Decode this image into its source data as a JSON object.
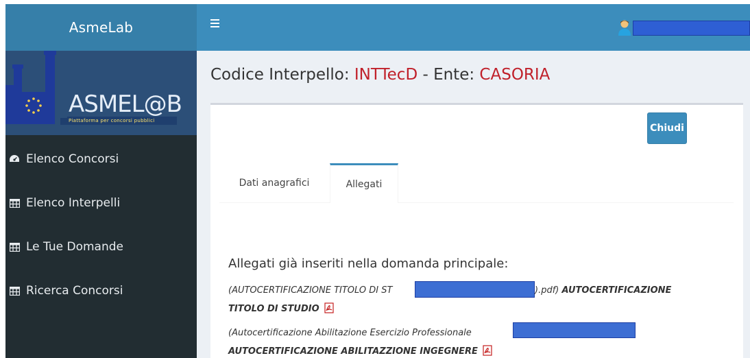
{
  "sidebar": {
    "brand": "AsmeLab",
    "logo_text": "ASMEL@B",
    "logo_sub": "Piattaforma per concorsi pubblici",
    "items": [
      {
        "label": "Elenco Concorsi",
        "icon": "dashboard-icon"
      },
      {
        "label": "Elenco Interpelli",
        "icon": "table-icon"
      },
      {
        "label": "Le Tue Domande",
        "icon": "table-icon"
      },
      {
        "label": "Ricerca Concorsi",
        "icon": "table-icon"
      }
    ]
  },
  "topbar": {
    "menu_icon": "hamburger-icon",
    "user_icon": "user-avatar-icon"
  },
  "page": {
    "title_prefix": "Codice Interpello: ",
    "codice": "INTTecD",
    "title_mid": " - Ente: ",
    "ente": "CASORIA",
    "close_button": "Chiudi",
    "tabs": [
      "Dati anagrafici",
      "Allegati"
    ],
    "allegati_title": "Allegati già inseriti nella domanda principale:",
    "allegati": [
      {
        "file_prefix": "(AUTOCERTIFICAZIONE TITOLO DI ST",
        "file_suffix": ").pdf)",
        "label_line1": "AUTOCERTIFICAZIONE",
        "label_line2": "TITOLO DI STUDIO"
      },
      {
        "file_prefix": "(Autocertificazione Abilitazione Esercizio Professionale",
        "label_line2": "AUTOCERTIFICAZIONE ABILITAZZIONE INGEGNERE"
      }
    ]
  },
  "colors": {
    "sidebar_bg": "#222d32",
    "topbar_bg": "#3c8dbc",
    "accent_red": "#c0202a",
    "redaction": "#3d6ed3"
  }
}
